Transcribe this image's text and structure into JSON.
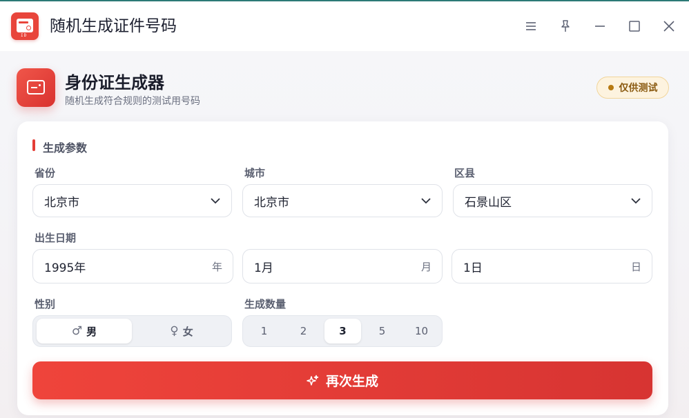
{
  "window": {
    "title": "随机生成证件号码",
    "app_icon_tag": "ID",
    "controls": [
      "menu-icon",
      "pin-icon",
      "minimize-icon",
      "maximize-icon",
      "close-icon"
    ]
  },
  "header": {
    "title": "身份证生成器",
    "subtitle": "随机生成符合规则的测试用号码",
    "badge": "仅供测试"
  },
  "section": {
    "title": "生成参数"
  },
  "form": {
    "province": {
      "label": "省份",
      "value": "北京市"
    },
    "city": {
      "label": "城市",
      "value": "北京市"
    },
    "district": {
      "label": "区县",
      "value": "石景山区"
    },
    "birth_label": "出生日期",
    "year": {
      "value": "1995年",
      "unit": "年"
    },
    "month": {
      "value": "1月",
      "unit": "月"
    },
    "day": {
      "value": "1日",
      "unit": "日"
    },
    "gender": {
      "label": "性别",
      "options": [
        {
          "symbol": "♂",
          "label": "男",
          "selected": true
        },
        {
          "symbol": "♀",
          "label": "女",
          "selected": false
        }
      ]
    },
    "count": {
      "label": "生成数量",
      "options": [
        "1",
        "2",
        "3",
        "5",
        "10"
      ],
      "selected": "3"
    }
  },
  "action": {
    "generate_label": "再次生成"
  },
  "colors": {
    "accent": "#e43d36",
    "badge_bg": "#fdf3df",
    "badge_text": "#8a5a10",
    "window_border": "#2c7a76"
  }
}
